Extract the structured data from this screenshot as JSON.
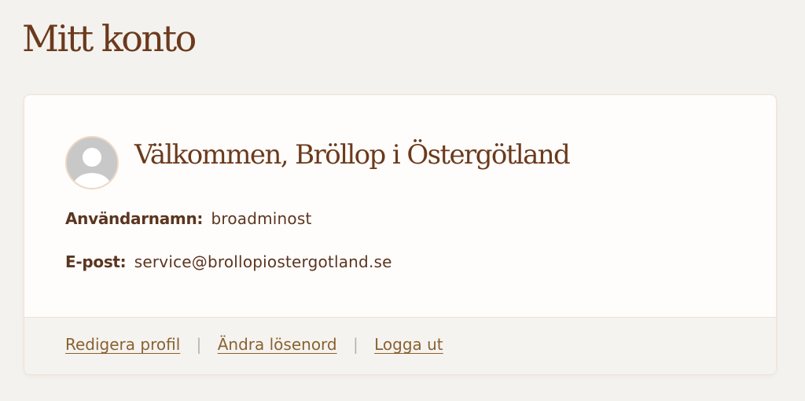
{
  "page": {
    "title": "Mitt konto"
  },
  "account": {
    "welcome": "Välkommen, Bröllop i Östergötland",
    "avatar_icon": "default-user-avatar-icon",
    "username_label": "Användarnamn:",
    "username_value": "broadminost",
    "email_label": "E-post:",
    "email_value": "service@brollopiostergotland.se"
  },
  "footer": {
    "links": [
      {
        "label": "Redigera profil"
      },
      {
        "label": "Ändra lösenord"
      },
      {
        "label": "Logga ut"
      }
    ],
    "separator": "|"
  },
  "colors": {
    "background": "#f4f2ef",
    "heading": "#6b3a1c",
    "text": "#5b3520",
    "link": "#8a6230",
    "card": "#fffdfb",
    "footer": "#f5f3f0"
  }
}
